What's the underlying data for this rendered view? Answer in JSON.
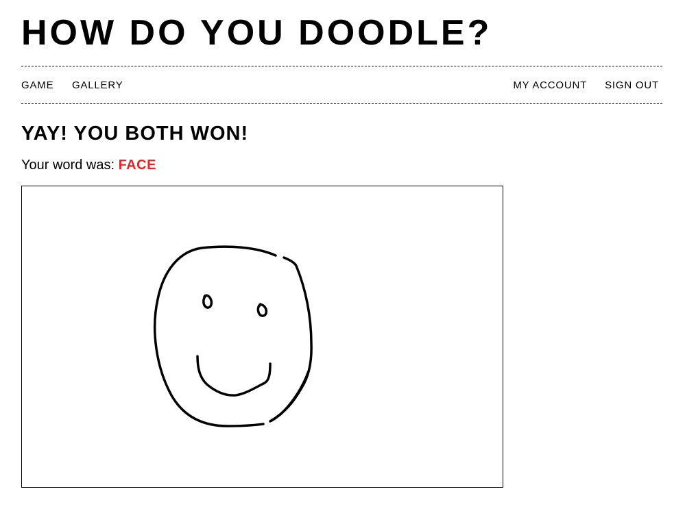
{
  "header": {
    "site_title": "HOW DO YOU DOODLE?"
  },
  "nav": {
    "left_items": [
      "GAME",
      "GALLERY"
    ],
    "right_items": [
      "MY ACCOUNT",
      "SIGN OUT"
    ]
  },
  "result": {
    "heading": "YAY! YOU BOTH WON!",
    "word_label": "Your word was:",
    "word": "FACE",
    "word_color": "#e32626"
  },
  "canvas": {
    "drawing_subject": "smiley face doodle",
    "stroke_color": "#000000",
    "background_color": "#ffffff"
  }
}
